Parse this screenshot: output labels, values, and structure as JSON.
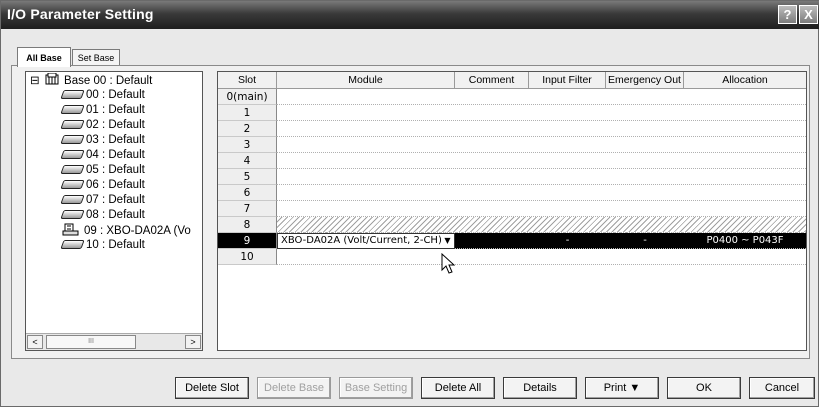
{
  "window": {
    "title": "I/O Parameter Setting",
    "help_label": "?",
    "close_label": "X"
  },
  "tabs": [
    {
      "label": "All Base",
      "active": true
    },
    {
      "label": "Set Base",
      "active": false
    }
  ],
  "tree": {
    "root": {
      "label": "Base 00 : Default",
      "expander": "⊟"
    },
    "children": [
      {
        "label": "00 : Default",
        "icon": "module-icon"
      },
      {
        "label": "01 : Default",
        "icon": "module-icon"
      },
      {
        "label": "02 : Default",
        "icon": "module-icon"
      },
      {
        "label": "03 : Default",
        "icon": "module-icon"
      },
      {
        "label": "04 : Default",
        "icon": "module-icon"
      },
      {
        "label": "05 : Default",
        "icon": "module-icon"
      },
      {
        "label": "06 : Default",
        "icon": "module-icon"
      },
      {
        "label": "07 : Default",
        "icon": "module-icon"
      },
      {
        "label": "08 : Default",
        "icon": "module-icon"
      },
      {
        "label": "09 : XBO-DA02A (Vo",
        "icon": "analog-module-icon"
      },
      {
        "label": "10 : Default",
        "icon": "module-icon"
      }
    ],
    "scroll_left": "<",
    "scroll_right": ">",
    "scroll_thumb": "III"
  },
  "grid": {
    "columns": [
      "Slot",
      "Module",
      "Comment",
      "Input Filter",
      "Emergency Out",
      "Allocation"
    ],
    "rows": [
      {
        "slot": "0(main)",
        "module": "",
        "comment": "",
        "input_filter": "",
        "emergency_out": "",
        "allocation": ""
      },
      {
        "slot": "1",
        "module": "",
        "comment": "",
        "input_filter": "",
        "emergency_out": "",
        "allocation": ""
      },
      {
        "slot": "2",
        "module": "",
        "comment": "",
        "input_filter": "",
        "emergency_out": "",
        "allocation": ""
      },
      {
        "slot": "3",
        "module": "",
        "comment": "",
        "input_filter": "",
        "emergency_out": "",
        "allocation": ""
      },
      {
        "slot": "4",
        "module": "",
        "comment": "",
        "input_filter": "",
        "emergency_out": "",
        "allocation": ""
      },
      {
        "slot": "5",
        "module": "",
        "comment": "",
        "input_filter": "",
        "emergency_out": "",
        "allocation": ""
      },
      {
        "slot": "6",
        "module": "",
        "comment": "",
        "input_filter": "",
        "emergency_out": "",
        "allocation": ""
      },
      {
        "slot": "7",
        "module": "",
        "comment": "",
        "input_filter": "",
        "emergency_out": "",
        "allocation": ""
      },
      {
        "slot": "8",
        "module": "",
        "comment": "",
        "input_filter": "",
        "emergency_out": "",
        "allocation": "",
        "hatched": true
      },
      {
        "slot": "9",
        "module": "XBO-DA02A (Volt/Current, 2-CH)",
        "comment": "",
        "input_filter": "-",
        "emergency_out": "-",
        "allocation": "P0400 ~ P043F",
        "selected": true
      },
      {
        "slot": "10",
        "module": "",
        "comment": "",
        "input_filter": "",
        "emergency_out": "",
        "allocation": ""
      }
    ],
    "dropdown_arrow": "▼"
  },
  "buttons": {
    "delete_slot": "Delete Slot",
    "delete_base": "Delete Base",
    "base_setting": "Base Setting",
    "delete_all": "Delete All",
    "details": "Details",
    "print": "Print  ▼",
    "ok": "OK",
    "cancel": "Cancel"
  },
  "colors": {
    "selected_row": "#000000",
    "titlebar": "#2a2a2a"
  }
}
